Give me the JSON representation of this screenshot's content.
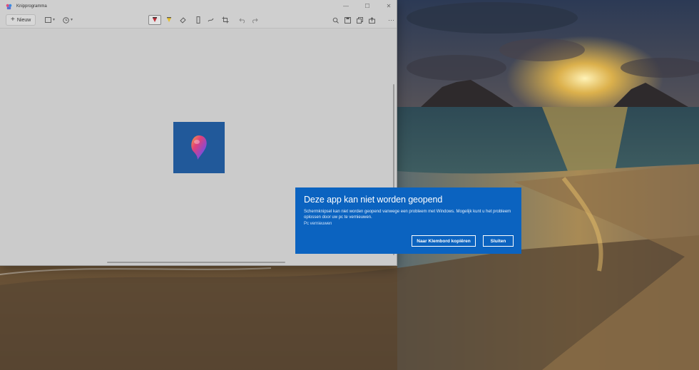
{
  "window": {
    "title": "Knipprogramma",
    "minimize_glyph": "—",
    "maximize_glyph": "☐",
    "close_glyph": "✕"
  },
  "toolbar": {
    "new_label": "Nieuw",
    "icons": [
      "snip-mode-icon",
      "delay-timer-icon",
      "ballpoint-pen-icon",
      "highlighter-icon",
      "eraser-icon",
      "ruler-icon",
      "touch-writing-icon",
      "crop-icon",
      "undo-icon",
      "redo-icon",
      "zoom-icon",
      "save-icon",
      "copy-icon",
      "share-icon",
      "more-icon"
    ],
    "more_glyph": "···"
  },
  "dialog": {
    "title": "Deze app kan niet worden geopend",
    "message": "Schermknipsel kan niet worden geopend vanwege een probleem met Windows. Mogelijk kunt u het probleem oplossen door uw pc te vernieuwen.",
    "link": "Pc vernieuwen",
    "copy_button": "Naar Klembord kopiëren",
    "close_button": "Sluiten",
    "background_color": "#0b63c0"
  },
  "colors": {
    "canvas": "#cbcbcb",
    "captured_tile": "#21599a"
  }
}
